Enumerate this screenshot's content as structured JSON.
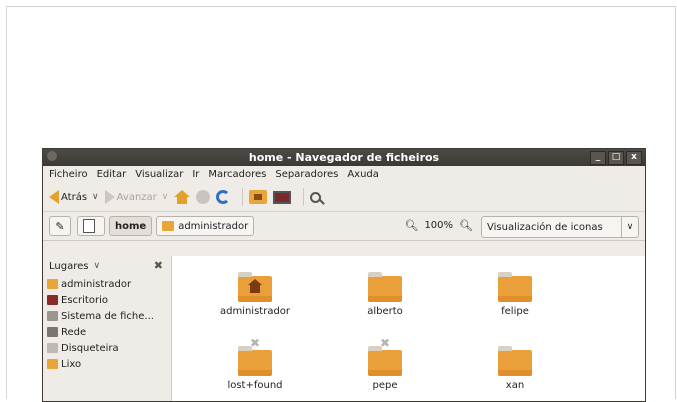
{
  "window": {
    "title": "home - Navegador de ficheiros",
    "buttons": {
      "minimize": "_",
      "maximize": "□",
      "close": "x"
    }
  },
  "menu": [
    "Ficheiro",
    "Editar",
    "Visualizar",
    "Ir",
    "Marcadores",
    "Separadores",
    "Axuda"
  ],
  "toolbar": {
    "back_label": "Atrás",
    "forward_label": "Avanzar"
  },
  "location": {
    "path": [
      "home",
      "administrador"
    ],
    "zoom": "100%",
    "view_mode": "Visualización de iconas"
  },
  "sidebar": {
    "header": "Lugares",
    "items": [
      {
        "label": "administrador",
        "icon": "home-folder-icon",
        "color": "#e7a53a"
      },
      {
        "label": "Escritorio",
        "icon": "desktop-icon",
        "color": "#8a2b2b"
      },
      {
        "label": "Sistema de fiche...",
        "icon": "drive-icon",
        "color": "#9a958f"
      },
      {
        "label": "Rede",
        "icon": "network-icon",
        "color": "#7a7570"
      },
      {
        "label": "Disqueteira",
        "icon": "floppy-icon",
        "color": "#bdb8b2"
      },
      {
        "label": "Lixo",
        "icon": "trash-icon",
        "color": "#e7a53a"
      }
    ]
  },
  "files": [
    {
      "name": "administrador",
      "type": "home-folder"
    },
    {
      "name": "alberto",
      "type": "folder"
    },
    {
      "name": "felipe",
      "type": "folder"
    },
    {
      "name": "lost+found",
      "type": "folder-locked"
    },
    {
      "name": "pepe",
      "type": "folder-locked"
    },
    {
      "name": "xan",
      "type": "folder"
    }
  ],
  "colors": {
    "accent": "#e7a53a",
    "titlebar": "#3f3b37"
  }
}
